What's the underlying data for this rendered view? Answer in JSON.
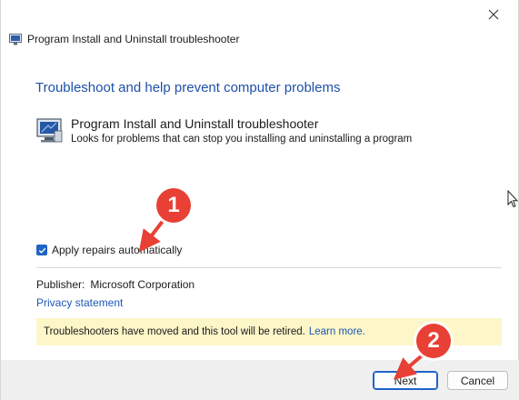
{
  "window": {
    "title": "Program Install and Uninstall troubleshooter",
    "close_glyph": "✕"
  },
  "content": {
    "headline": "Troubleshoot and help prevent computer problems",
    "troubleshooter": {
      "title": "Program Install and Uninstall troubleshooter",
      "description": "Looks for problems that can stop you installing and uninstalling a program",
      "icon": "monitor-wrench-icon"
    },
    "apply_repairs": {
      "label": "Apply repairs automatically",
      "checked": true
    },
    "publisher": {
      "label": "Publisher:",
      "value": "Microsoft Corporation"
    },
    "privacy_link": "Privacy statement",
    "banner": {
      "text": "Troubleshooters have moved and this tool will be retired.",
      "link": "Learn more."
    }
  },
  "footer": {
    "next_label": "Next",
    "cancel_label": "Cancel"
  },
  "annotations": {
    "marker_1": "1",
    "marker_2": "2",
    "color": "#e84034"
  }
}
